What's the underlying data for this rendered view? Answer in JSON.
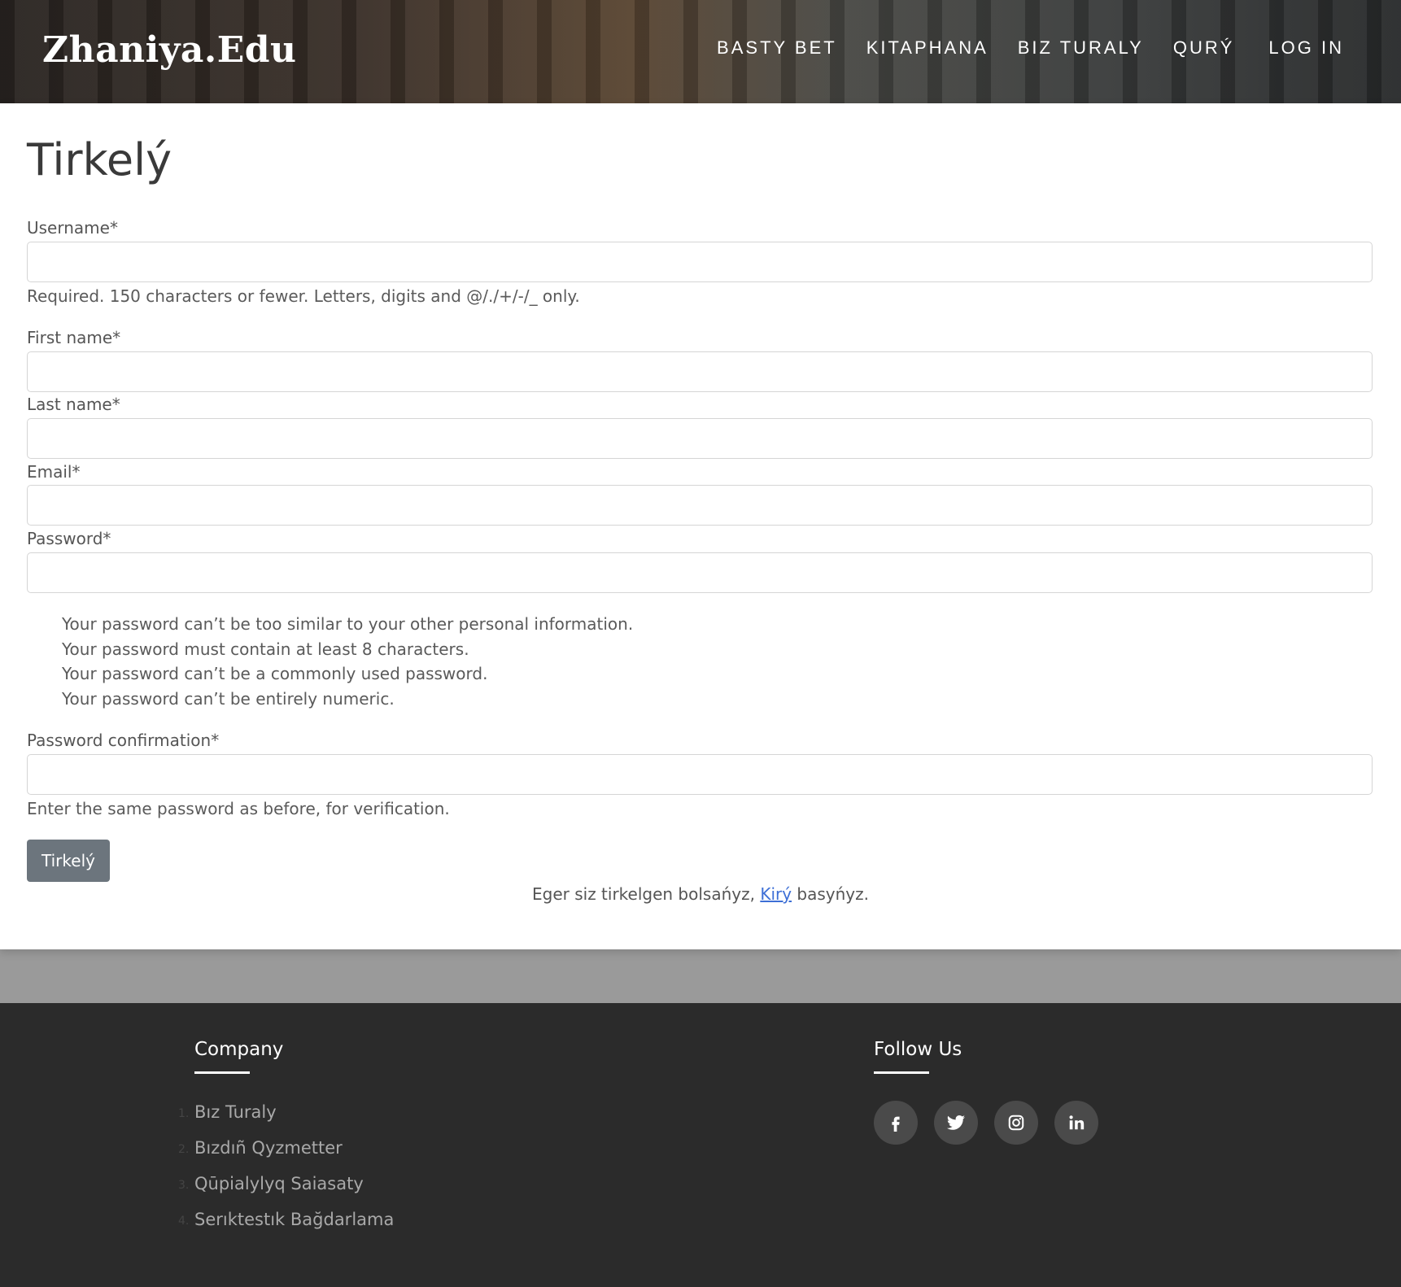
{
  "header": {
    "brand": "Zhaniya.Edu",
    "nav": [
      "BASTY BET",
      "KITAPHANA",
      "BIZ TURALY",
      "QURÝ",
      "LOG IN"
    ]
  },
  "form": {
    "title": "Tirkelý",
    "username_label": "Username*",
    "username_help": "Required. 150 characters or fewer. Letters, digits and @/./+/-/_ only.",
    "first_name_label": "First name*",
    "last_name_label": "Last name*",
    "email_label": "Email*",
    "password_label": "Password*",
    "password_rules": [
      "Your password can’t be too similar to your other personal information.",
      "Your password must contain at least 8 characters.",
      "Your password can’t be a commonly used password.",
      "Your password can’t be entirely numeric."
    ],
    "password_confirm_label": "Password confirmation*",
    "password_confirm_help": "Enter the same password as before, for verification.",
    "submit_label": "Tirkelý",
    "login_prefix": "Eger siz tirkelgen bolsańyz, ",
    "login_link": "Kirý",
    "login_suffix": " basyńyz."
  },
  "footer": {
    "company_heading": "Company",
    "company_links": [
      "Bız Turaly",
      "Bızdıñ Qyzmetter",
      "Qūpialylyq Saiasaty",
      "Serıktestık Bağdarlama"
    ],
    "follow_heading": "Follow Us",
    "social_icons": [
      "facebook-icon",
      "twitter-icon",
      "instagram-icon",
      "linkedin-icon"
    ]
  }
}
